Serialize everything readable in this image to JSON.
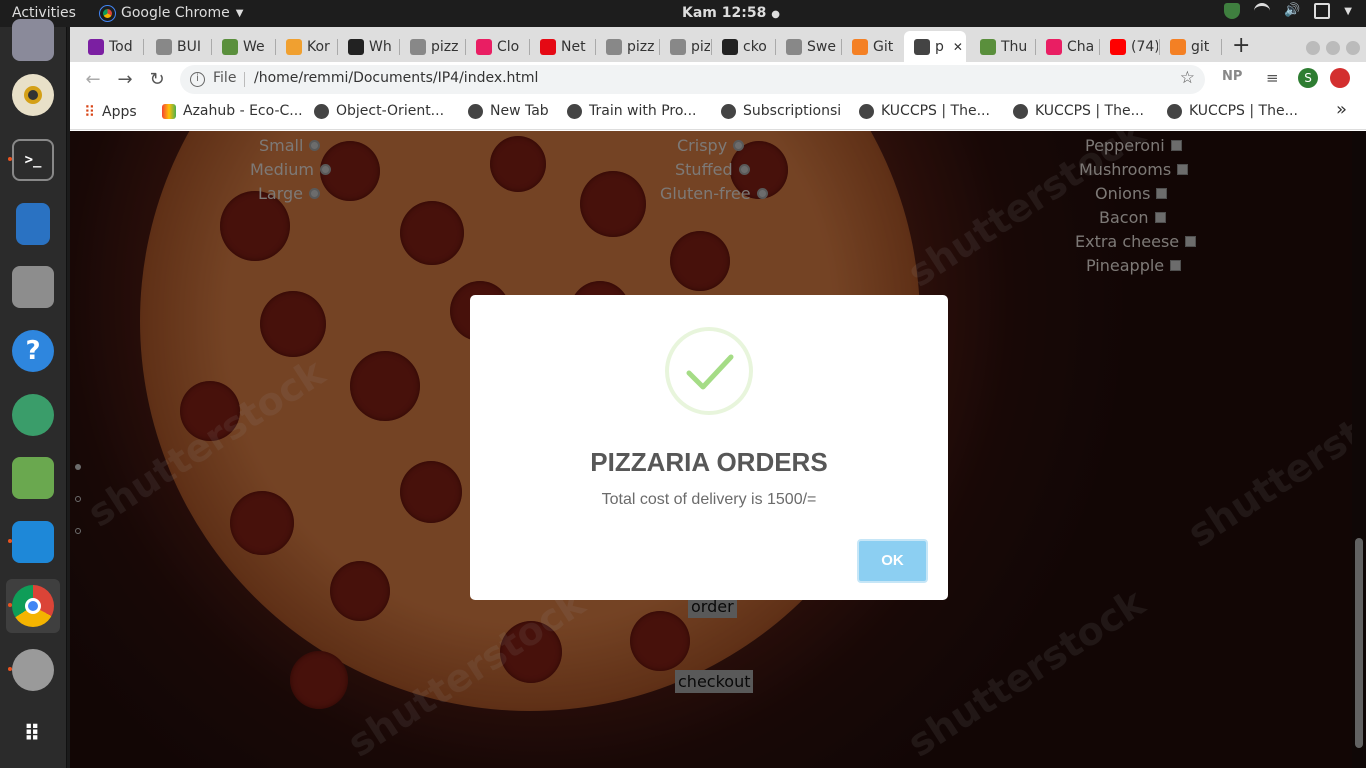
{
  "topbar": {
    "activities": "Activities",
    "app_name": "Google Chrome",
    "clock": "Kam 12:58"
  },
  "browser": {
    "tabs": [
      {
        "label": "Tod",
        "color": "#7b1fa2"
      },
      {
        "label": "BUI",
        "color": "#888888"
      },
      {
        "label": "We",
        "color": "#5a8f3c"
      },
      {
        "label": "Kor",
        "color": "#f0a030"
      },
      {
        "label": "Wh",
        "color": "#222222"
      },
      {
        "label": "pizz",
        "color": "#888888"
      },
      {
        "label": "Clo",
        "color": "#e91e63"
      },
      {
        "label": "Net",
        "color": "#e50914"
      },
      {
        "label": "pizz",
        "color": "#888888"
      },
      {
        "label": "pizz",
        "color": "#888888"
      },
      {
        "label": "cko",
        "color": "#222222"
      },
      {
        "label": "Swe",
        "color": "#888888"
      },
      {
        "label": "Git",
        "color": "#f48024"
      },
      {
        "label": "p",
        "color": "#444444"
      },
      {
        "label": "Thu",
        "color": "#5a8f3c"
      },
      {
        "label": "Cha",
        "color": "#e91e63"
      },
      {
        "label": "(74)",
        "color": "#ff0000"
      },
      {
        "label": "git",
        "color": "#f48024"
      }
    ],
    "address_scheme": "File",
    "address": "/home/remmi/Documents/IP4/index.html",
    "extension_label": "NP",
    "profile_initial": "S",
    "bookmarks": [
      "Apps",
      "Azahub - Eco-C...",
      "Object-Orient...",
      "New Tab",
      "Train with Pro...",
      "Subscriptionsi",
      "KUCCPS | The...",
      "KUCCPS | The...",
      "KUCCPS | The..."
    ],
    "bookmarks_more": "»"
  },
  "page": {
    "sizes": [
      "Small",
      "Medium",
      "Large"
    ],
    "crusts": [
      "Crispy",
      "Stuffed",
      "Gluten-free"
    ],
    "toppings": [
      "Pepperoni",
      "Mushrooms",
      "Onions",
      "Bacon",
      "Extra cheese",
      "Pineapple"
    ],
    "order_button": "order",
    "checkout_button": "checkout",
    "watermark": "shutterstock"
  },
  "modal": {
    "title": "PIZZARIA ORDERS",
    "text": "Total cost of delivery is 1500/=",
    "ok_label": "OK"
  },
  "colors": {
    "ok_button": "#8ccff2",
    "success_check": "#a5dc86",
    "accent_dot": "#e95420"
  }
}
